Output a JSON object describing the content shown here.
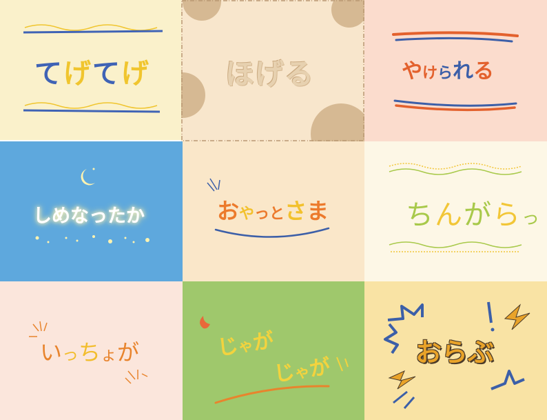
{
  "panels": [
    {
      "id": "p1",
      "text": "てげてげ",
      "chars": [
        "て",
        "げ",
        "て",
        "げ"
      ],
      "bg": "#faf1cb"
    },
    {
      "id": "p2",
      "text": "ほげる",
      "bg": "#f8e6cc"
    },
    {
      "id": "p3",
      "text": "やけられる",
      "chars": [
        "や",
        "け",
        "ら",
        "れ",
        "る"
      ],
      "bg": "#fbdccd"
    },
    {
      "id": "p4",
      "text": "しめなったか",
      "bg": "#5ea8dd"
    },
    {
      "id": "p5",
      "text": "おやっとさま",
      "chars": [
        "お",
        "や",
        "っ",
        "と",
        "さ",
        "ま"
      ],
      "bg": "#fae7c9"
    },
    {
      "id": "p6",
      "text": "ちんがらっ",
      "chars": [
        "ち",
        "ん",
        "が",
        "ら",
        "っ"
      ],
      "bg": "#fdf7e6"
    },
    {
      "id": "p7",
      "text": "いっちょが",
      "chars": [
        "い",
        "っ",
        "ち",
        "ょ",
        "が"
      ],
      "bg": "#fbe6dc"
    },
    {
      "id": "p8",
      "lines": [
        "じゃが",
        "じゃが"
      ],
      "chars1": [
        "じ",
        "ゃ",
        "が"
      ],
      "chars2": [
        "じ",
        "ゃ",
        "が"
      ],
      "bg": "#9fc86c"
    },
    {
      "id": "p9",
      "text": "おらぶ",
      "bg": "#f9e3a4"
    }
  ],
  "colors": {
    "blue": "#3f63b5",
    "yellow": "#f0c52e",
    "orange": "#e3612d",
    "green": "#a8c94a",
    "tan": "#d6b993"
  }
}
